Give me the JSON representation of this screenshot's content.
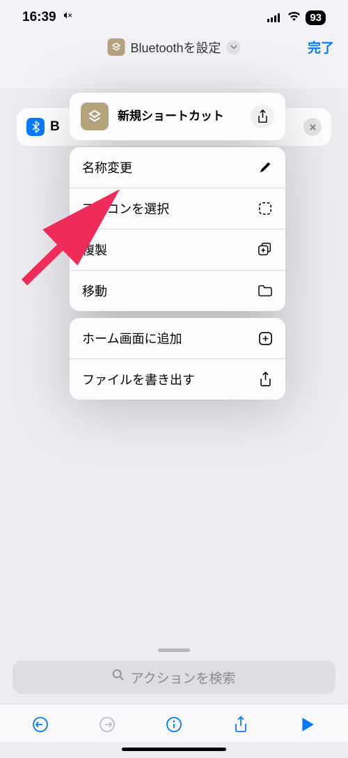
{
  "statusBar": {
    "time": "16:39",
    "battery": "93"
  },
  "nav": {
    "title": "Bluetoothを設定",
    "done": "完了"
  },
  "bgPill": {
    "label": "B"
  },
  "popup": {
    "headerTitle": "新規ショートカット",
    "menu1": {
      "rename": "名称変更",
      "chooseIcon": "アイコンを選択",
      "duplicate": "複製",
      "move": "移動"
    },
    "menu2": {
      "addToHome": "ホーム画面に追加",
      "exportFile": "ファイルを書き出す"
    }
  },
  "search": {
    "placeholder": "アクションを検索"
  }
}
